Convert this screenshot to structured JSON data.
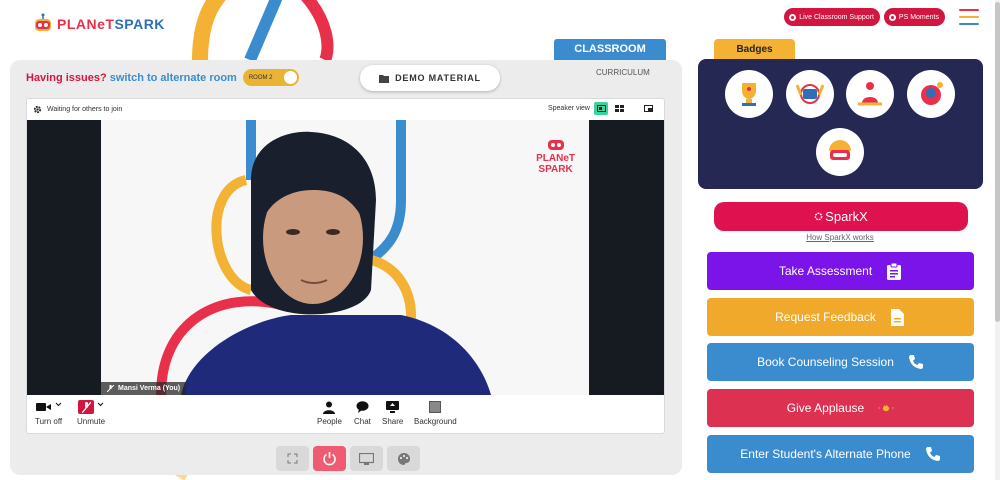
{
  "brand": {
    "part1": "PLANeT",
    "part2": "SPARK",
    "colors": {
      "red": "#e8304a",
      "blue": "#2f6fb8",
      "yellow": "#f4b234"
    }
  },
  "header": {
    "live_support": "Live Classroom Support",
    "ps_moments": "PS Moments",
    "menu_icon": "hamburger-icon"
  },
  "tabs": {
    "classroom": "CLASSROOM",
    "curriculum": "CURRICULUM"
  },
  "issues": {
    "question": "Having issues?",
    "switch": "switch to alternate room",
    "room": "ROOM 2"
  },
  "demo_material": "DEMO MATERIAL",
  "video": {
    "status": "Waiting for others to join",
    "speaker_view": "Speaker view",
    "participant": "Mansi Verma (You)",
    "watermark_line1": "PLANeT",
    "watermark_line2": "SPARK"
  },
  "controls": {
    "turn_off": "Turn off",
    "unmute": "Unmute",
    "people": "People",
    "chat": "Chat",
    "share": "Share",
    "background": "Background"
  },
  "badges": {
    "title": "Badges",
    "count": 5
  },
  "sparkx": {
    "label": "SparkX",
    "link": "How SparkX works"
  },
  "actions": [
    {
      "label": "Take Assessment",
      "color": "#7b14e8",
      "icon": "clipboard-icon"
    },
    {
      "label": "Request Feedback",
      "color": "#f0a92b",
      "icon": "document-icon"
    },
    {
      "label": "Book Counseling Session",
      "color": "#3b8ccf",
      "icon": "phone-icon"
    },
    {
      "label": "Give Applause",
      "color": "#dc3150",
      "icon": "clap-icon"
    },
    {
      "label": "Enter Student's Alternate Phone",
      "color": "#3b8ccf",
      "icon": "phone-icon"
    }
  ]
}
